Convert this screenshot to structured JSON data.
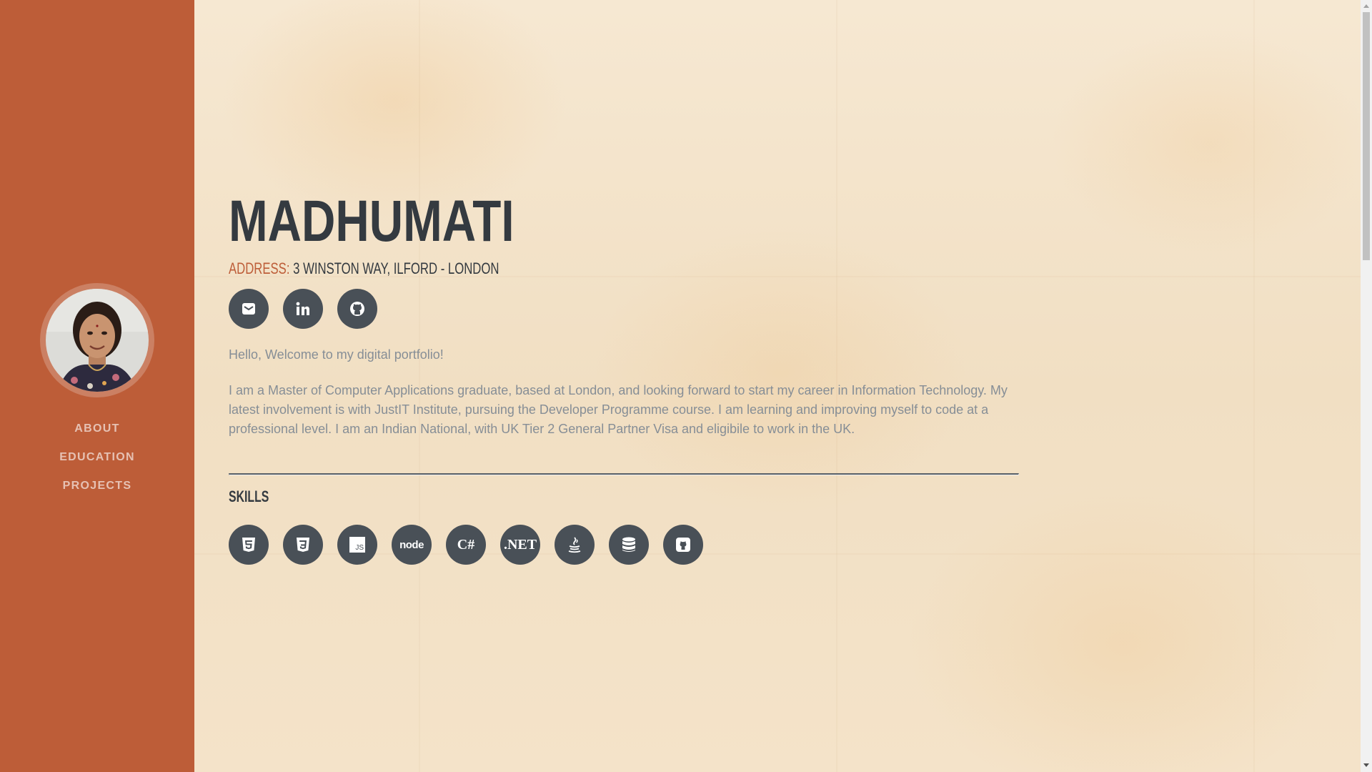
{
  "sidebar": {
    "background_color": "#bd5d38",
    "nav": [
      {
        "label": "ABOUT"
      },
      {
        "label": "EDUCATION"
      },
      {
        "label": "PROJECTS"
      }
    ]
  },
  "header": {
    "name": "MADHUMATI",
    "address_label": "ADDRESS:",
    "address_value": "3 WINSTON WAY, ILFORD - LONDON"
  },
  "social": [
    {
      "name": "email",
      "icon": "envelope-icon"
    },
    {
      "name": "linkedin",
      "icon": "linkedin-icon"
    },
    {
      "name": "github",
      "icon": "github-icon"
    }
  ],
  "about": {
    "greeting": "Hello, Welcome to my digital portfolio!",
    "bio": "I am a Master of Computer Applications graduate, based at London, and looking forward to start my career in Information Technology. My latest involvement is with JustIT Institute, pursuing the Developer Programme course. I am learning and improving myself to code at a professional level. I am an Indian National, with UK Tier 2 General Partner Visa and eligibile to work in the UK."
  },
  "skills": {
    "title": "SKILLS",
    "items": [
      {
        "icon": "html5-icon"
      },
      {
        "icon": "css3-icon"
      },
      {
        "icon": "javascript-icon",
        "text": "JS"
      },
      {
        "icon": "nodejs-icon",
        "text": "node"
      },
      {
        "icon": "csharp-icon",
        "text": "C#"
      },
      {
        "icon": "dotnet-icon",
        "text": ".NET"
      },
      {
        "icon": "java-icon"
      },
      {
        "icon": "database-icon"
      },
      {
        "icon": "github-icon"
      }
    ]
  },
  "colors": {
    "accent": "#bd5d38",
    "heading": "#343a40",
    "body_text": "#868e96",
    "icon_circle": "#495057"
  }
}
